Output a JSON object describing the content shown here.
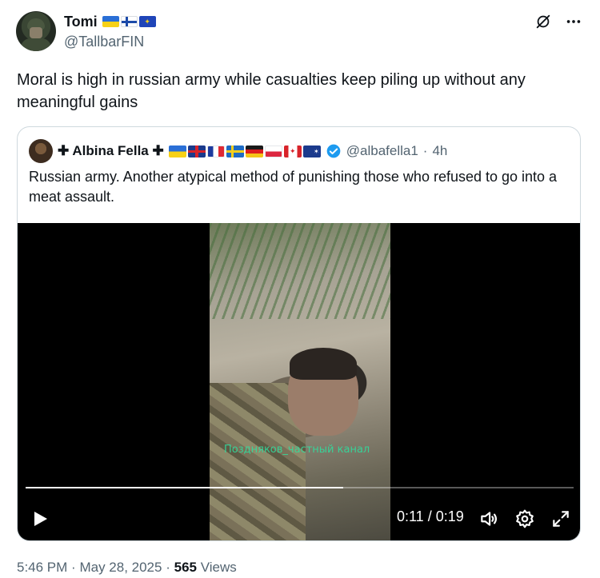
{
  "author": {
    "display_name": "Tomi",
    "handle": "@TallbarFIN",
    "flags": [
      "ukraine-flag",
      "finland-flag",
      "eu-flag"
    ]
  },
  "tweet": {
    "text": "Moral is high in russian army while casualties keep piling up without any meaningful gains"
  },
  "quoted": {
    "cross_prefix": "✚",
    "display_name": "Albina Fella",
    "cross_suffix": "✚",
    "flags": [
      "ukraine-flag",
      "uk-flag",
      "france-flag",
      "sweden-flag",
      "germany-flag",
      "poland-flag",
      "canada-flag",
      "australia-flag"
    ],
    "handle": "@albafella1",
    "separator": "·",
    "time_ago": "4h",
    "text": "Russian army. Another atypical method of punishing those who refused to go into a meat assault.",
    "video": {
      "overlay_caption": "Поздняков_частный канал",
      "current_time": "0:11",
      "duration": "0:19",
      "time_sep": "/",
      "progress_fraction": 0.579
    }
  },
  "meta": {
    "time": "5:46 PM",
    "dot1": "·",
    "date": "May 28, 2025",
    "dot2": "·",
    "views_count": "565",
    "views_label": "Views"
  },
  "colors": {
    "text": "#0f1419",
    "secondary": "#536471",
    "verified": "#1d9bf0",
    "border": "#cfd9de",
    "caption": "#2ee0a0"
  }
}
